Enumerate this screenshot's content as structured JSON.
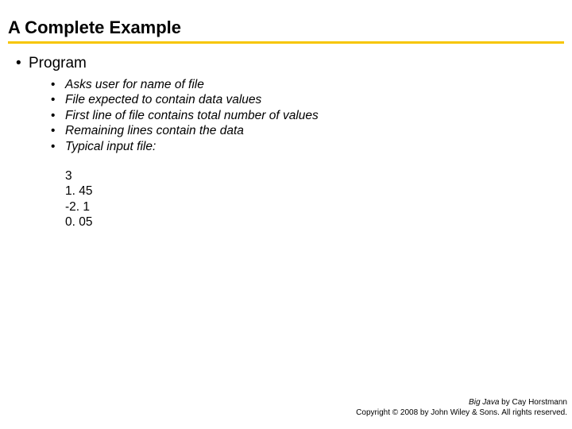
{
  "slide": {
    "title": "A Complete Example",
    "mainBullet": "Program",
    "subBullets": [
      "Asks user for name of file",
      "File expected to contain data values",
      "First line of file contains total number of values",
      "Remaining lines contain the data",
      "Typical input file:"
    ],
    "code": [
      "3",
      "1. 45",
      "-2. 1",
      "0. 05"
    ],
    "footer": {
      "book": "Big Java",
      "byline": " by Cay Horstmann",
      "copyright": "Copyright © 2008 by John Wiley & Sons. All rights reserved."
    }
  }
}
